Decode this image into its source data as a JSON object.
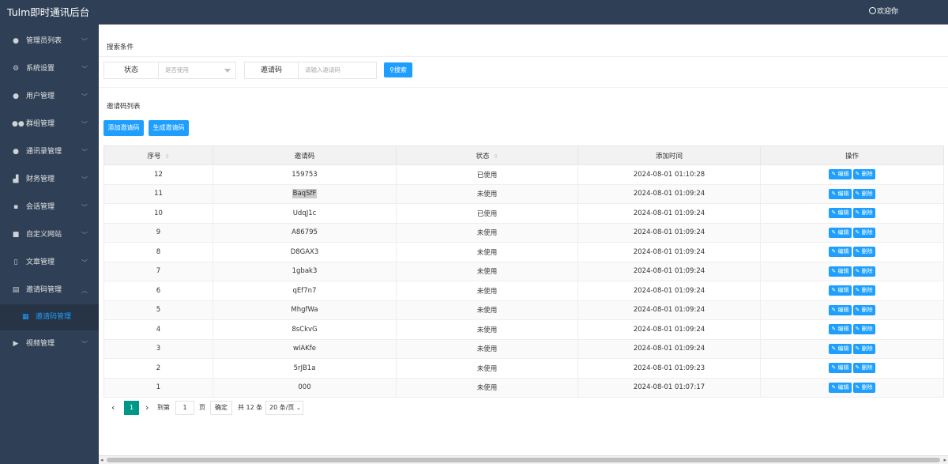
{
  "app": {
    "title": "Tulm即时通讯后台",
    "greeting": "欢迎你"
  },
  "sidebar": {
    "items": [
      {
        "label": "管理员列表",
        "icon": "user-icon"
      },
      {
        "label": "系统设置",
        "icon": "gear-icon"
      },
      {
        "label": "用户管理",
        "icon": "user-icon"
      },
      {
        "label": "群组管理",
        "icon": "group-icon"
      },
      {
        "label": "通讯录管理",
        "icon": "contact-icon"
      },
      {
        "label": "财务管理",
        "icon": "finance-icon"
      },
      {
        "label": "会话管理",
        "icon": "chat-icon"
      },
      {
        "label": "自定义网站",
        "icon": "monitor-icon"
      },
      {
        "label": "文章管理",
        "icon": "article-icon"
      },
      {
        "label": "邀请码管理",
        "icon": "document-icon"
      },
      {
        "label": "视频管理",
        "icon": "video-icon"
      }
    ],
    "active_sub": {
      "label": "邀请码管理",
      "icon": "grid-icon"
    }
  },
  "search": {
    "section_title": "搜索条件",
    "status_label": "状态",
    "status_placeholder": "是否使用",
    "code_label": "邀请码",
    "code_placeholder": "请输入邀请码",
    "search_button": "搜索"
  },
  "list": {
    "section_title": "邀请码列表",
    "add_button": "添加邀请码",
    "generate_button": "生成邀请码",
    "columns": [
      "序号",
      "邀请码",
      "状态",
      "添加时间",
      "操作"
    ],
    "edit_label": "编辑",
    "delete_label": "删除",
    "rows": [
      {
        "id": "12",
        "code": "159753",
        "status": "已使用",
        "used": true,
        "time": "2024-08-01 01:10:28"
      },
      {
        "id": "11",
        "code": "BaqSfF",
        "status": "未使用",
        "used": false,
        "time": "2024-08-01 01:09:24"
      },
      {
        "id": "10",
        "code": "UdqJ1c",
        "status": "已使用",
        "used": true,
        "time": "2024-08-01 01:09:24"
      },
      {
        "id": "9",
        "code": "A86795",
        "status": "未使用",
        "used": false,
        "time": "2024-08-01 01:09:24"
      },
      {
        "id": "8",
        "code": "D8GAX3",
        "status": "未使用",
        "used": false,
        "time": "2024-08-01 01:09:24"
      },
      {
        "id": "7",
        "code": "1gbak3",
        "status": "未使用",
        "used": false,
        "time": "2024-08-01 01:09:24"
      },
      {
        "id": "6",
        "code": "qEf7n7",
        "status": "未使用",
        "used": false,
        "time": "2024-08-01 01:09:24"
      },
      {
        "id": "5",
        "code": "MhgfWa",
        "status": "未使用",
        "used": false,
        "time": "2024-08-01 01:09:24"
      },
      {
        "id": "4",
        "code": "8sCkvG",
        "status": "未使用",
        "used": false,
        "time": "2024-08-01 01:09:24"
      },
      {
        "id": "3",
        "code": "wIAKfe",
        "status": "未使用",
        "used": false,
        "time": "2024-08-01 01:09:24"
      },
      {
        "id": "2",
        "code": "5rJB1a",
        "status": "未使用",
        "used": false,
        "time": "2024-08-01 01:09:23"
      },
      {
        "id": "1",
        "code": "000",
        "status": "未使用",
        "used": false,
        "time": "2024-08-01 01:07:17"
      }
    ]
  },
  "pagination": {
    "current_page": "1",
    "goto_prefix": "到第",
    "goto_value": "1",
    "goto_suffix": "页",
    "confirm": "确定",
    "total": "共 12 条",
    "page_size": "20 条/页"
  },
  "colors": {
    "sidebar_bg": "#2f4056",
    "accent": "#1e9fff",
    "used": "#ff2222",
    "page_active": "#009688"
  }
}
